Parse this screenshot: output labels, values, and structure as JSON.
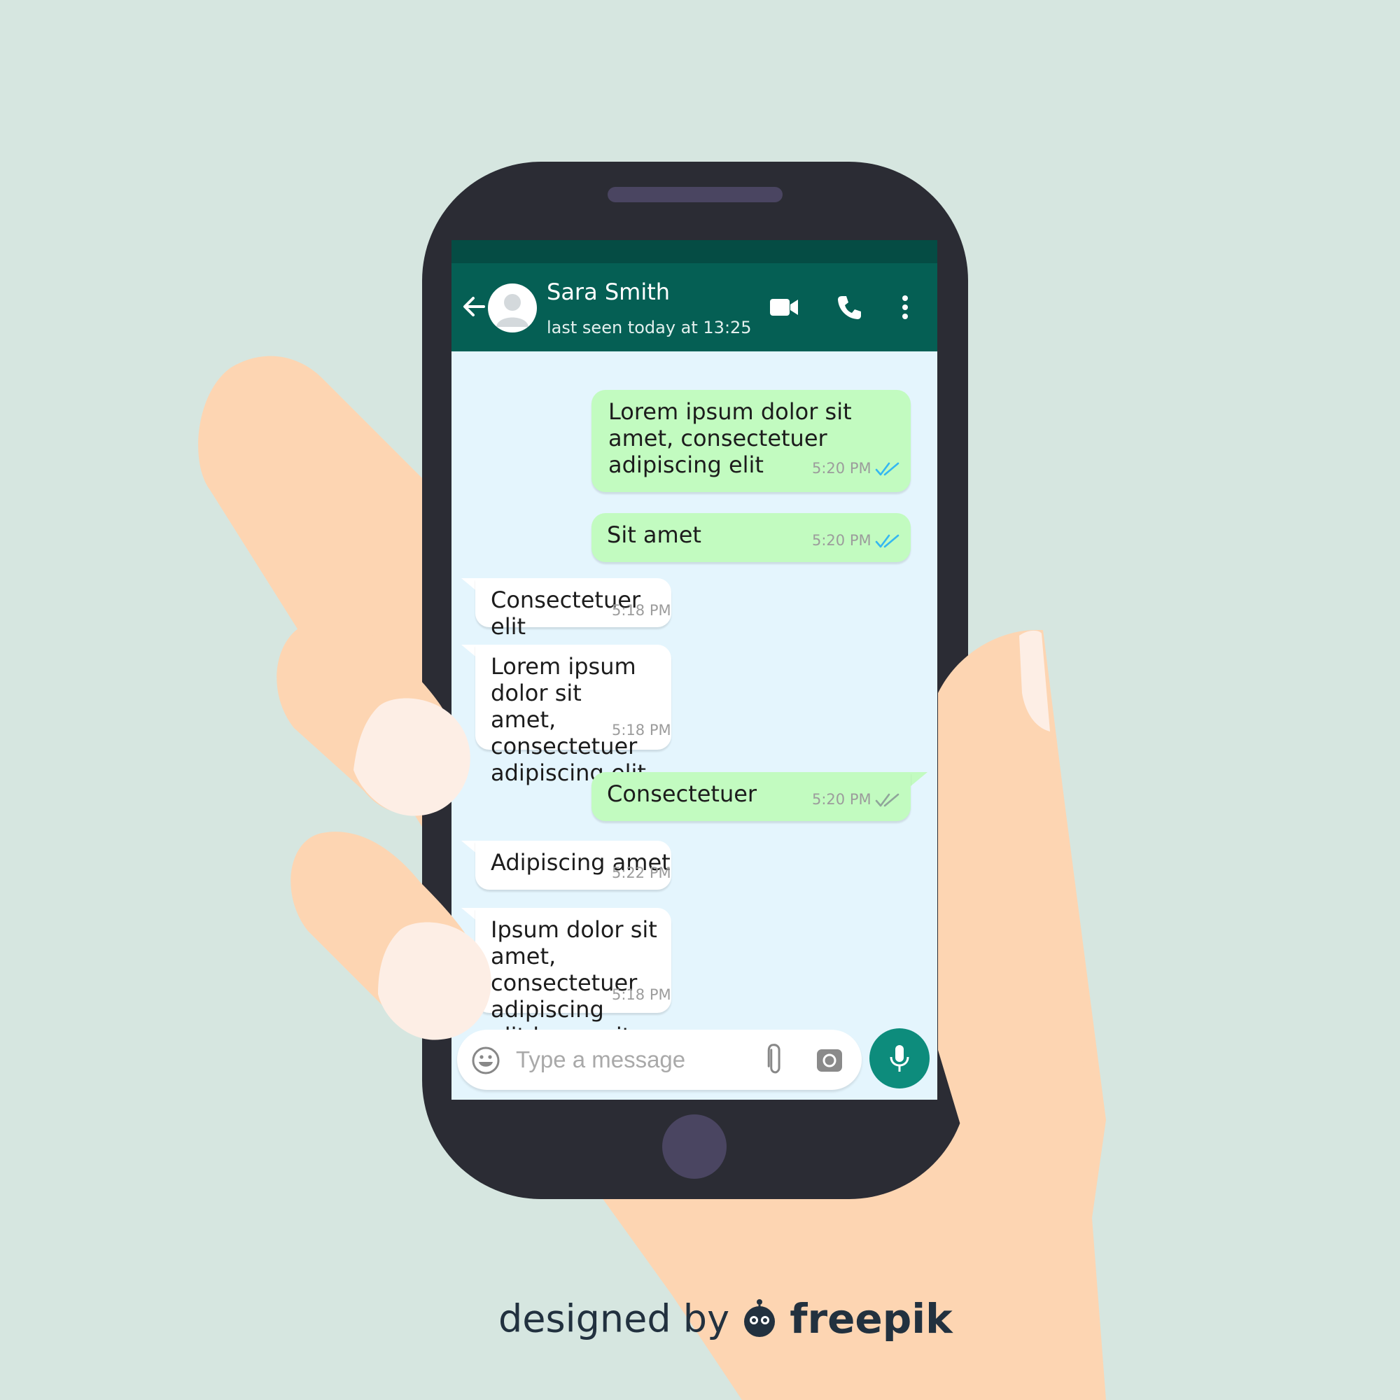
{
  "contact": {
    "name": "Sara Smith",
    "status": "last seen today at 13:25"
  },
  "header_icons": [
    "back-arrow-icon",
    "avatar-icon",
    "video-call-icon",
    "phone-icon",
    "more-vert-icon"
  ],
  "messages": [
    {
      "direction": "out",
      "text": "Lorem ipsum dolor sit\namet, consectetuer\nadipiscing elit",
      "time": "5:20 PM",
      "read": true
    },
    {
      "direction": "out",
      "text": "Sit amet",
      "time": "5:20 PM",
      "read": true
    },
    {
      "direction": "in",
      "text": "Consectetuer elit",
      "time": "5:18 PM"
    },
    {
      "direction": "in",
      "text": "Lorem ipsum dolor sit\namet, consectetuer\nadipiscing elit",
      "time": "5:18 PM"
    },
    {
      "direction": "out",
      "text": "Consectetuer",
      "time": "5:20 PM",
      "read": false
    },
    {
      "direction": "in",
      "text": "Adipiscing amet",
      "time": "5:22 PM"
    },
    {
      "direction": "in",
      "text": "Ipsum dolor sit amet,\nconsectetuer adipiscing\nelit lorem sit",
      "time": "5:18 PM"
    }
  ],
  "composer": {
    "placeholder": "Type a message",
    "icons": [
      "emoji-icon",
      "attach-icon",
      "camera-icon",
      "mic-icon"
    ]
  },
  "credit": {
    "prefix": "designed by",
    "brand": "freepik"
  },
  "colors": {
    "background": "#d6e6e0",
    "header": "#055f54",
    "status_bar": "#054c44",
    "chat_background": "#e4f5fd",
    "outgoing_bubble": "#c2fbc0",
    "incoming_bubble": "#ffffff",
    "read_ticks": "#34b7f1",
    "unread_ticks": "#8fa59a",
    "mic_button": "#0d8c7c",
    "phone_body": "#2b2c34",
    "skin": "#fdd5b2"
  }
}
